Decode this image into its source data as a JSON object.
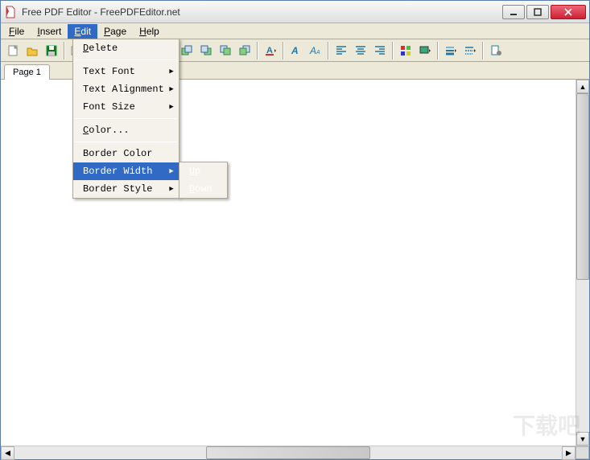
{
  "title": "Free PDF Editor - FreePDFEditor.net",
  "menubar": {
    "file": "File",
    "insert": "Insert",
    "edit": "Edit",
    "page": "Page",
    "help": "Help"
  },
  "tabs": {
    "page1": "Page 1"
  },
  "edit_menu": {
    "delete": "Delete",
    "text_font": "Text Font",
    "text_alignment": "Text Alignment",
    "font_size": "Font Size",
    "color": "Color...",
    "border_color": "Border Color",
    "border_width": "Border Width",
    "border_style": "Border Style"
  },
  "border_width_submenu": {
    "up": "Up",
    "down": "Down"
  },
  "watermark": "下载吧"
}
